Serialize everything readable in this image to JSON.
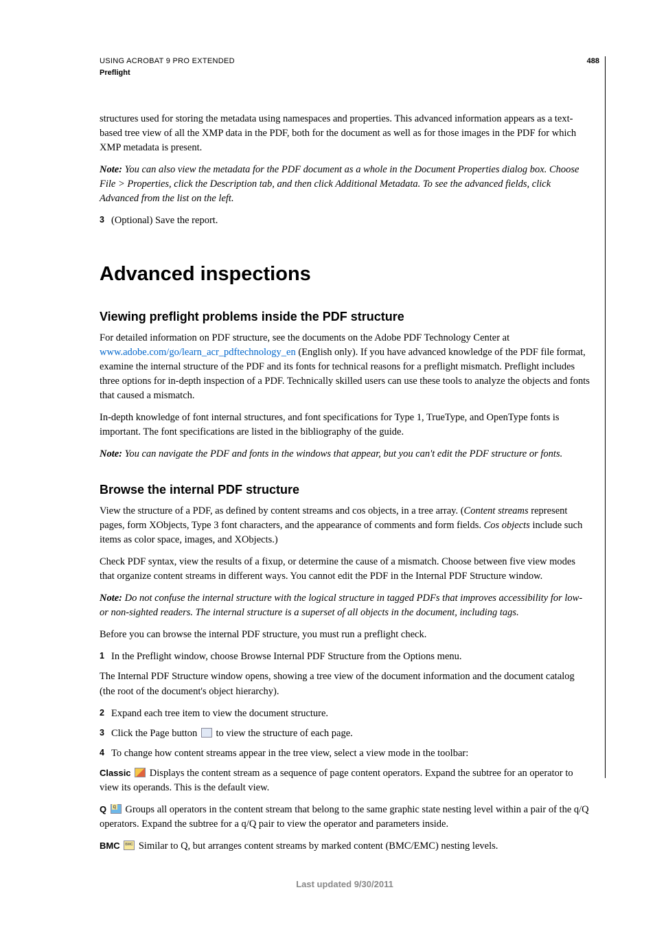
{
  "header": {
    "title": "USING ACROBAT 9 PRO EXTENDED",
    "section": "Preflight",
    "page_number": "488"
  },
  "intro": {
    "paragraph": "structures used for storing the metadata using namespaces and properties. This advanced information appears as a text-based tree view of all the XMP data in the PDF, both for the document as well as for those images in the PDF for which XMP metadata is present.",
    "note_label": "Note:",
    "note_text": " You can also view the metadata for the PDF document as a whole in the Document Properties dialog box. Choose File > Properties, click the Description tab, and then click Additional Metadata. To see the advanced fields, click Advanced from the list on the left.",
    "step3_num": "3",
    "step3_text": "(Optional) Save the report."
  },
  "h1": "Advanced inspections",
  "section1": {
    "heading": "Viewing preflight problems inside the PDF structure",
    "p1_before": "For detailed information on PDF structure, see the documents on the Adobe PDF Technology Center at ",
    "link_text": "www.adobe.com/go/learn_acr_pdftechnology_en",
    "p1_after": " (English only). If you have advanced knowledge of the PDF file format, examine the internal structure of the PDF and its fonts for technical reasons for a preflight mismatch. Preflight includes three options for in-depth inspection of a PDF. Technically skilled users can use these tools to analyze the objects and fonts that caused a mismatch.",
    "p2": "In-depth knowledge of font internal structures, and font specifications for Type 1, TrueType, and OpenType fonts is important. The font specifications are listed in the bibliography of the guide.",
    "note_label": "Note:",
    "note_text": " You can navigate the PDF and fonts in the windows that appear, but you can't edit the PDF structure or fonts."
  },
  "section2": {
    "heading": "Browse the internal PDF structure",
    "p1_before": "View the structure of a PDF, as defined by content streams and cos objects, in a tree array. (",
    "p1_cs": "Content streams",
    "p1_mid": " represent pages, form XObjects, Type 3 font characters, and the appearance of comments and form fields. ",
    "p1_cos": "Cos objects",
    "p1_after": " include such items as color space, images, and XObjects.)",
    "p2": "Check PDF syntax, view the results of a fixup, or determine the cause of a mismatch. Choose between five view modes that organize content streams in different ways. You cannot edit the PDF in the Internal PDF Structure window.",
    "note_label": "Note:",
    "note_text": " Do not confuse the internal structure with the logical structure in tagged PDFs that improves accessibility for low- or non-sighted readers. The internal structure is a superset of all objects in the document, including tags.",
    "p3": "Before you can browse the internal PDF structure, you must run a preflight check.",
    "step1_num": "1",
    "step1_text": "In the Preflight window, choose Browse Internal PDF Structure from the Options menu.",
    "p4": "The Internal PDF Structure window opens, showing a tree view of the document information and the document catalog (the root of the document's object hierarchy).",
    "step2_num": "2",
    "step2_text": "Expand each tree item to view the document structure.",
    "step3_num": "3",
    "step3_before": "Click the Page button ",
    "step3_after": " to view the structure of each page.",
    "step4_num": "4",
    "step4_text": "To change how content streams appear in the tree view, select a view mode in the toolbar:",
    "classic_label": "Classic",
    "classic_text": "  Displays the content stream as a sequence of page content operators. Expand the subtree for an operator to view its operands. This is the default view.",
    "q_label": "Q",
    "q_text": "  Groups all operators in the content stream that belong to the same graphic state nesting level within a pair of the q/Q operators. Expand the subtree for a q/Q pair to view the operator and parameters inside.",
    "bmc_label": "BMC",
    "bmc_text": "  Similar to Q, but arranges content streams by marked content (BMC/EMC) nesting levels."
  },
  "footer": "Last updated 9/30/2011"
}
